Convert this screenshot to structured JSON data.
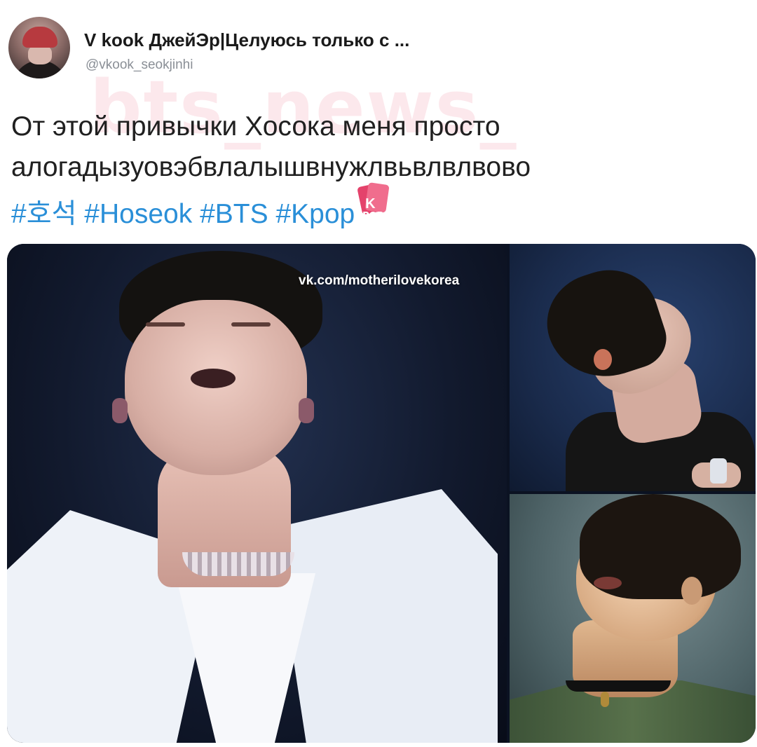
{
  "tweet": {
    "display_name": "V kook ДжейЭр|Целуюсь только с ...",
    "handle": "@vkook_seokjinhi",
    "watermark": "bts_news_",
    "text_lines": [
      "От этой привычки Хосока меня просто",
      "алогадызуовэбвлалышвнужлвьвлвлвово"
    ],
    "hashtags": [
      "#호석",
      "#Hoseok",
      "#BTS",
      "#Kpop"
    ],
    "kpop_badge": {
      "top": "K",
      "bottom": "POP"
    }
  },
  "media": {
    "photo_watermark": "vk.com/motherilovekorea",
    "photo_count": 3
  },
  "colors": {
    "hashtag": "#2a8fd8",
    "name": "#1a1a1a",
    "handle": "#8a8f96",
    "watermark": "#f096aa"
  }
}
